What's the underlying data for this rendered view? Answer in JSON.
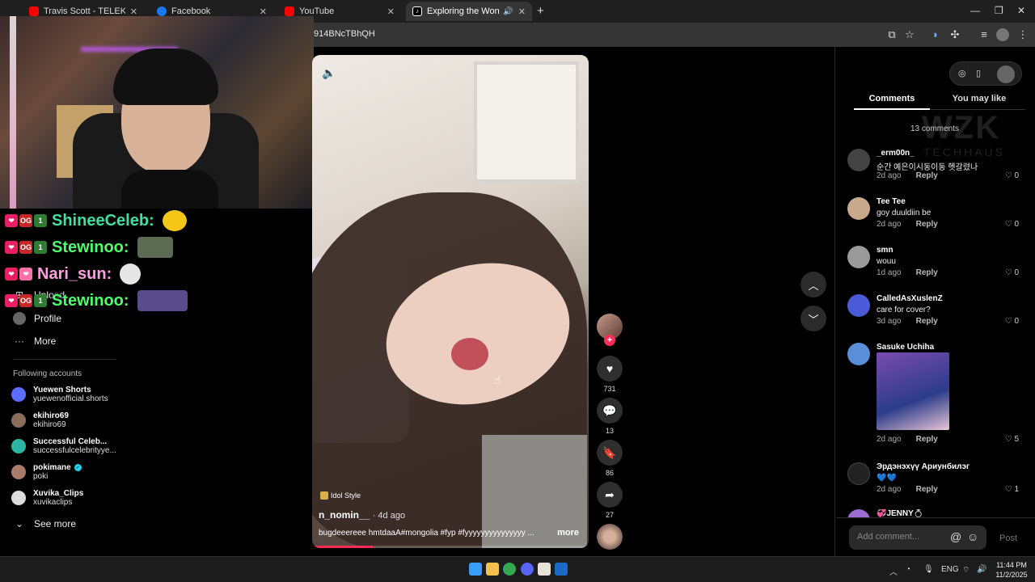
{
  "browser": {
    "tabs": [
      {
        "title": "Travis Scott - TELEKINESIS (Offi",
        "favicon": "youtube-icon",
        "color": "#ff0000",
        "active": false
      },
      {
        "title": "Facebook",
        "favicon": "facebook-icon",
        "color": "#1877f2",
        "active": false
      },
      {
        "title": "YouTube",
        "favicon": "youtube-icon",
        "color": "#ff0000",
        "active": false
      },
      {
        "title": "Exploring the Wonders of M",
        "favicon": "tiktok-icon",
        "color": "#000000",
        "active": true
      }
    ],
    "url": "914BNcTBhQH"
  },
  "stream_chat": [
    {
      "user": "ShineeCeleb:",
      "color": "#3de0a0",
      "badges": [
        "❤",
        "OG",
        "1"
      ]
    },
    {
      "user": "Stewinoo:",
      "color": "#4cff6a",
      "badges": [
        "❤",
        "OG",
        "1"
      ]
    },
    {
      "user": "Nari_sun:",
      "color": "#ff9ee0",
      "badges": [
        "❤",
        "❤"
      ]
    },
    {
      "user": "Stewinoo:",
      "color": "#4cff6a",
      "badges": [
        "❤",
        "OG",
        "1"
      ]
    }
  ],
  "sidebar": {
    "nav": [
      {
        "label": "Upload",
        "icon": "plus-square-icon"
      },
      {
        "label": "Profile",
        "icon": "profile-icon"
      },
      {
        "label": "More",
        "icon": "more-icon"
      }
    ],
    "following_title": "Following accounts",
    "accounts": [
      {
        "name": "Yuewen Shorts",
        "handle": "yuewenofficial.shorts",
        "verified": false,
        "color": "#5b6cff"
      },
      {
        "name": "ekihiro69",
        "handle": "ekihiro69",
        "verified": false,
        "color": "#8a6d5b"
      },
      {
        "name": "Successful Celeb...",
        "handle": "successfulcelebrityye...",
        "verified": false,
        "color": "#2bb5a0"
      },
      {
        "name": "pokimane",
        "handle": "poki",
        "verified": true,
        "color": "#a87b6a"
      },
      {
        "name": "Xuvika_Clips",
        "handle": "xuvikaclips",
        "verified": false,
        "color": "#dddddd"
      }
    ],
    "see_more": "See more"
  },
  "video": {
    "tag": "Idol Style",
    "author": "n_nomin__",
    "age": "· 4d ago",
    "caption": "bugdeeereee hmtdaaA#mongolia #fyp #fyyyyyyyyyyyyyyy ...",
    "more_label": "more",
    "progress": 0.22
  },
  "actions": {
    "likes": "731",
    "comments": "13",
    "saves": "86",
    "shares": "27"
  },
  "panel": {
    "tabs": [
      "Comments",
      "You may like"
    ],
    "count_label": "13 comments",
    "watermark": "WZK",
    "watermark_sub": "TECHHAUS",
    "comments": [
      {
        "name": "_erm00n_",
        "text": "순간 예은이시동이동 헷갈렸나",
        "time": "2d ago",
        "likes": "0",
        "color": "#444"
      },
      {
        "name": "Tee Tee",
        "text": "goy duuldiin be",
        "time": "2d ago",
        "likes": "0",
        "color": "#c9a98c"
      },
      {
        "name": "smn",
        "text": "wouu",
        "time": "1d ago",
        "likes": "0",
        "color": "#9a9a9a"
      },
      {
        "name": "CalledAsXuslenZ",
        "text": "care for cover?",
        "time": "3d ago",
        "likes": "0",
        "color": "#4b5bd8"
      },
      {
        "name": "Sasuke Uchiha",
        "text": "",
        "time": "2d ago",
        "likes": "5",
        "color": "#5a8fd8"
      },
      {
        "name": "Эрдэнэхүү Ариунбилэг",
        "text": "💙💙",
        "time": "2d ago",
        "likes": "1",
        "color": "#222"
      },
      {
        "name": "💞JENNY💍",
        "text": "",
        "time": "",
        "likes": "",
        "color": "#9b6bd0"
      }
    ],
    "reply_label": "Reply",
    "add_comment_placeholder": "Add comment...",
    "post_label": "Post"
  },
  "taskbar": {
    "lang": "ENG",
    "time": "11:44 PM",
    "date": "11/2/2025"
  }
}
